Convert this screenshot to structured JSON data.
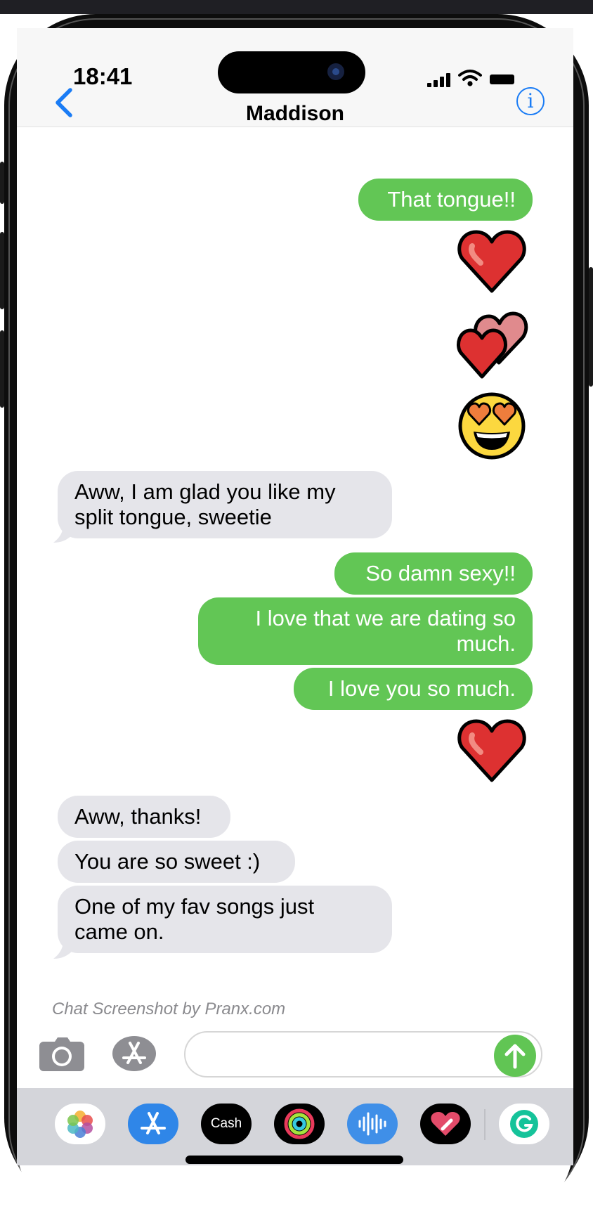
{
  "status_bar": {
    "time": "18:41"
  },
  "header": {
    "contact_name": "Maddison"
  },
  "messages": [
    {
      "from": "me",
      "type": "text",
      "text": "That tongue!!"
    },
    {
      "from": "me",
      "type": "emoji",
      "icon": "red-heart-icon"
    },
    {
      "from": "me",
      "type": "emoji",
      "icon": "two-hearts-icon"
    },
    {
      "from": "me",
      "type": "emoji",
      "icon": "heart-eyes-face-icon"
    },
    {
      "from": "them",
      "type": "text",
      "text_lines": [
        "Aww, I am glad you like my",
        "split tongue, sweetie"
      ]
    },
    {
      "from": "me",
      "type": "text",
      "text": "So damn sexy!!"
    },
    {
      "from": "me",
      "type": "text",
      "text_lines": [
        "I love that we are dating so",
        "much."
      ]
    },
    {
      "from": "me",
      "type": "text",
      "text": "I love you so much."
    },
    {
      "from": "me",
      "type": "emoji",
      "icon": "red-heart-icon"
    },
    {
      "from": "them",
      "type": "text",
      "text": "Aww, thanks!"
    },
    {
      "from": "them",
      "type": "text",
      "text": "You are so sweet :)"
    },
    {
      "from": "them",
      "type": "text",
      "text_lines": [
        "One of my fav songs just",
        "came on."
      ]
    }
  ],
  "watermark": "Chat Screenshot by Pranx.com",
  "input_bar": {
    "message_value": "",
    "icons": [
      "camera-icon",
      "app-store-icon",
      "send-arrow-icon"
    ]
  },
  "dock": {
    "apps": [
      {
        "icon": "photos-icon"
      },
      {
        "icon": "app-store-icon"
      },
      {
        "icon": "cash-app-icon",
        "label": "Cash"
      },
      {
        "icon": "fitness-rings-icon"
      },
      {
        "icon": "audio-waveform-icon"
      },
      {
        "icon": "digital-touch-heart-icon"
      },
      {
        "icon": "grammarly-icon"
      }
    ]
  },
  "colors": {
    "sent_bubble": "#62c655",
    "received_bubble": "#e5e5ea",
    "accent_blue": "#1a7cf5",
    "heart_red": "#dd3131"
  }
}
